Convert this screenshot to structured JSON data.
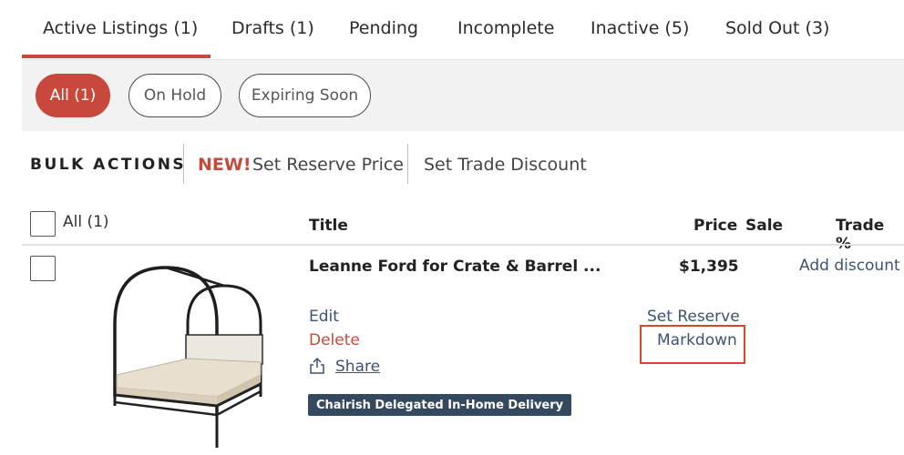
{
  "tabs": [
    {
      "label": "Active Listings (1)",
      "active": true
    },
    {
      "label": "Drafts (1)"
    },
    {
      "label": "Pending"
    },
    {
      "label": "Incomplete"
    },
    {
      "label": "Inactive (5)"
    },
    {
      "label": "Sold Out (3)"
    }
  ],
  "filters": [
    {
      "label": "All (1)",
      "active": true
    },
    {
      "label": "On Hold"
    },
    {
      "label": "Expiring Soon"
    }
  ],
  "bulk_actions": {
    "label": "BULK ACTIONS",
    "new_tag": "NEW!",
    "reserve_label": "Set Reserve Price",
    "trade_label": "Set Trade Discount"
  },
  "table": {
    "select_all_label": "All (1)",
    "headers": {
      "title": "Title",
      "price": "Price",
      "sale": "Sale",
      "trade": "Trade %"
    }
  },
  "listing": {
    "title": "Leanne Ford for Crate & Barrel ...",
    "price": "$1,395",
    "add_discount_label": "Add discount",
    "edit_label": "Edit",
    "delete_label": "Delete",
    "share_label": "Share",
    "set_reserve_label": "Set Reserve",
    "markdown_label": "Markdown",
    "delivery_badge": "Chairish Delegated In-Home Delivery",
    "image_icon": "canopy-bed-image"
  },
  "colors": {
    "accent": "#c7493b",
    "link": "#3d5370",
    "badge_bg": "#34495e",
    "highlight_box": "#d9462e"
  }
}
